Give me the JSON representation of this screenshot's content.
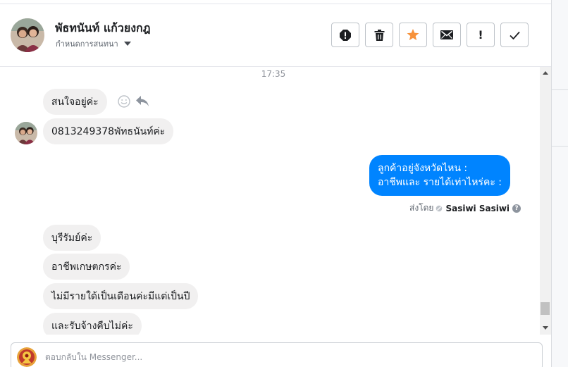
{
  "header": {
    "contact_name": "พัธทนันท์ แก้วยงกฎ",
    "label_dropdown": "กำหนดการสนทนา",
    "actions": [
      {
        "name": "spam-button",
        "icon": "alert-circle-icon"
      },
      {
        "name": "delete-button",
        "icon": "trash-icon"
      },
      {
        "name": "star-button",
        "icon": "star-icon",
        "color": "#f7923b"
      },
      {
        "name": "mark-unread-button",
        "icon": "envelope-icon"
      },
      {
        "name": "follow-up-button",
        "icon": "exclamation-icon",
        "glyph": "!"
      },
      {
        "name": "mark-done-button",
        "icon": "checkmark-icon"
      }
    ]
  },
  "thread": {
    "timestamp": "17:35",
    "messages": [
      {
        "direction": "in",
        "text": "สนใจอยู่ค่ะ"
      },
      {
        "direction": "in",
        "text": "0813249378พัทธนันท์ค่ะ"
      },
      {
        "direction": "out",
        "lines": [
          "ลูกค้าอยู่จังหวัดไหน :",
          "อาชีพและ รายได้เท่าไหร่คะ :"
        ]
      },
      {
        "direction": "in",
        "text": "บุรีรัมย์ค่ะ"
      },
      {
        "direction": "in",
        "text": "อาชีพเกษตกรค่ะ"
      },
      {
        "direction": "in",
        "text": "ไม่มีรายใด้เป็นเดือนค่ะมีแต่เป็นปี"
      },
      {
        "direction": "in",
        "text": "และรับจ้างคืบไม่ค่ะ"
      }
    ],
    "sent_by_label": "ส่งโดย",
    "sent_by_name": "Sasiwi Sasiwi",
    "help_glyph": "?"
  },
  "composer": {
    "placeholder": "ตอบกลับใน Messenger..."
  },
  "colors": {
    "outgoing_bubble": "#0084ff",
    "incoming_bubble": "#f1f0f0",
    "star": "#f7923b"
  }
}
